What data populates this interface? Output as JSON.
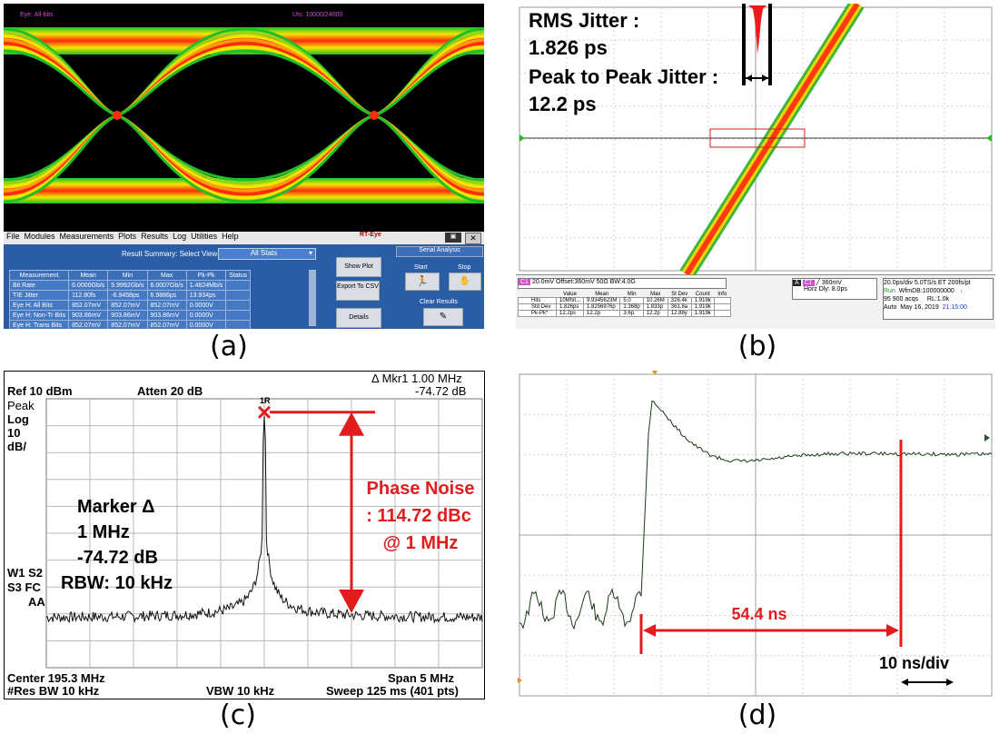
{
  "captions": [
    "(a)",
    "(b)",
    "(c)",
    "(d)"
  ],
  "panel_a": {
    "top_left_label": "Eye: All-bits",
    "top_right_label": "UIs: 10000/24000",
    "menu": [
      "File",
      "Modules",
      "Measurements",
      "Plots",
      "Results",
      "Log",
      "Utilities",
      "Help"
    ],
    "brand": "RT-Eye",
    "result_summary_label": "Result Summary: Select View",
    "view_select": "All Stats",
    "serial_analysis": "Serial Analysis",
    "buttons": {
      "show_plot": "Show Plot",
      "export": "Export To CSV",
      "details": "Details",
      "start": "Start",
      "stop": "Stop",
      "clear": "Clear Results"
    },
    "table": {
      "headers": [
        "Measurement",
        "Mean",
        "Min",
        "Max",
        "Pk-Pk",
        "Status"
      ],
      "rows": [
        [
          "Bit Rate",
          "6.0000Gb/s",
          "5.9992Gb/s",
          "6.0007Gb/s",
          "1.4824Mb/s",
          ""
        ],
        [
          "TIE Jitter",
          "112.80fs",
          "-6.9458ps",
          "6.9886ps",
          "13.934ps",
          ""
        ],
        [
          "Eye H: All Bits",
          "852.07mV",
          "852.07mV",
          "852.07mV",
          "0.0000V",
          ""
        ],
        [
          "Eye H: Non-Tr Bits",
          "903.86mV",
          "903.86mV",
          "903.86mV",
          "0.0000V",
          ""
        ],
        [
          "Eye H: Trans Bits",
          "852.07mV",
          "852.07mV",
          "852.07mV",
          "0.0000V",
          ""
        ]
      ]
    }
  },
  "panel_b": {
    "rms_label": "RMS Jitter :",
    "rms_value": "1.826 ps",
    "pp_label": "Peak to Peak Jitter :",
    "pp_value": "12.2 ps",
    "ch_settings": "20.0mV  Offset:360mV  50Ω  BW:4.0G",
    "trigger": "360mV",
    "horz_dly": "Horz Dly:  8.0ps",
    "timebase": "20.0ps/div  5.0TS/s  ET  200fs/pt",
    "run": "Run",
    "wfmdb": "WfmDB:100000000",
    "acqs": "95 900 acqs",
    "rl": "RL:1.0k",
    "auto": "Auto",
    "date": "May 16, 2019",
    "time": "21:15:00",
    "stats_headers": [
      "Value",
      "Mean",
      "Min",
      "Max",
      "St Dev",
      "Count",
      "Info"
    ],
    "stats_rows": [
      [
        "Hits",
        "10Mhit...",
        "9.9345623M",
        "5.0",
        "10.26M",
        "326.4k",
        "1.919k",
        ""
      ],
      [
        "Std Dev",
        "1.826ps",
        "1.8256976p",
        "1.368p",
        "1.833p",
        "361.8a",
        "1.919k",
        ""
      ],
      [
        "Pk-Pk*",
        "12.2ps",
        "12.2p",
        "3.6p",
        "12.2p",
        "12.88y",
        "1.919k",
        ""
      ]
    ]
  },
  "panel_c": {
    "ref": "Ref 10 dBm",
    "atten": "Atten 20 dB",
    "mkr": "Δ Mkr1  1.00 MHz",
    "mkr_val": "-74.72 dB",
    "peak": "Peak",
    "log": "Log",
    "log_val": "10",
    "units": "dB/",
    "w1": "W1  S2",
    "s3": "S3  FC",
    "aa": "AA",
    "marker_label": "Marker Δ",
    "marker_freq": "1 MHz",
    "marker_db": "-74.72 dB",
    "rbw": "RBW: 10 kHz",
    "pn_line1": "Phase Noise",
    "pn_line2": ": 114.72 dBc",
    "pn_line3": "@ 1 MHz",
    "center": "Center 195.3 MHz",
    "span": "Span 5 MHz",
    "res_bw": "#Res BW 10 kHz",
    "vbw": "VBW 10 kHz",
    "sweep": "Sweep 125 ms (401 pts)",
    "marker_tag": "1R"
  },
  "panel_d": {
    "delay_label": "54.4 ns",
    "scale_label": "10 ns/div"
  },
  "chart_data": [
    {
      "type": "heatmap",
      "panel": "a",
      "description_kind": "eye diagram"
    },
    {
      "type": "heatmap",
      "panel": "b",
      "description_kind": "jitter histogram on edge"
    },
    {
      "type": "line",
      "panel": "c",
      "xlabel": "",
      "ylabel": "",
      "x_center_mhz": 195.3,
      "span_mhz": 5,
      "ref_dbm": 10,
      "db_per_div": 10,
      "peak_freq_mhz": 195.3,
      "marker_offset_mhz": 1.0,
      "marker_delta_db": -74.72
    },
    {
      "type": "line",
      "panel": "d",
      "xlabel": "",
      "ylabel": "",
      "time_per_div_ns": 10,
      "measured_delay_ns": 54.4
    }
  ]
}
